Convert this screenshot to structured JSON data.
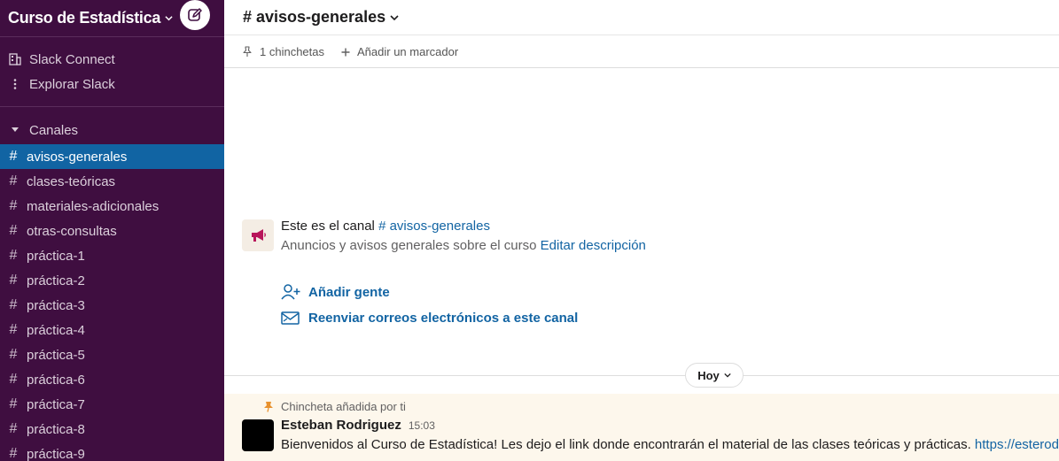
{
  "workspace": {
    "name": "Curso de Estadística"
  },
  "sidebar": {
    "nav": [
      {
        "label": "Slack Connect",
        "icon": "building-icon"
      },
      {
        "label": "Explorar Slack",
        "icon": "more-vertical-icon"
      }
    ],
    "section_label": "Canales",
    "channels": [
      {
        "name": "avisos-generales",
        "active": true
      },
      {
        "name": "clases-teóricas"
      },
      {
        "name": "materiales-adicionales"
      },
      {
        "name": "otras-consultas"
      },
      {
        "name": "práctica-1"
      },
      {
        "name": "práctica-2"
      },
      {
        "name": "práctica-3"
      },
      {
        "name": "práctica-4"
      },
      {
        "name": "práctica-5"
      },
      {
        "name": "práctica-6"
      },
      {
        "name": "práctica-7"
      },
      {
        "name": "práctica-8"
      },
      {
        "name": "práctica-9"
      }
    ]
  },
  "header": {
    "channel_title": "# avisos-generales"
  },
  "bookmarks": {
    "pins_label": "1 chinchetas",
    "add_label": "Añadir un marcador"
  },
  "intro": {
    "line1_prefix": "Este es el canal ",
    "channel_link": "# avisos-generales",
    "description": "Anuncios y avisos generales sobre el curso ",
    "edit_link": "Editar descripción",
    "add_people": "Añadir gente",
    "forward_email": "Reenviar correos electrónicos a este canal"
  },
  "day_divider": "Hoy",
  "message": {
    "pin_note": "Chincheta añadida por ti",
    "author": "Esteban Rodriguez",
    "time": "15:03",
    "text": "Bienvenidos al Curso de Estadística! Les dejo el link donde encontrarán el material de las clases teóricas y prácticas. ",
    "link": "https://esterodr.github.io"
  },
  "colors": {
    "sidebar_bg": "#3f0e40",
    "active_channel": "#1164a3",
    "link": "#1264a3",
    "pinned_bg": "#fdf7ec"
  }
}
